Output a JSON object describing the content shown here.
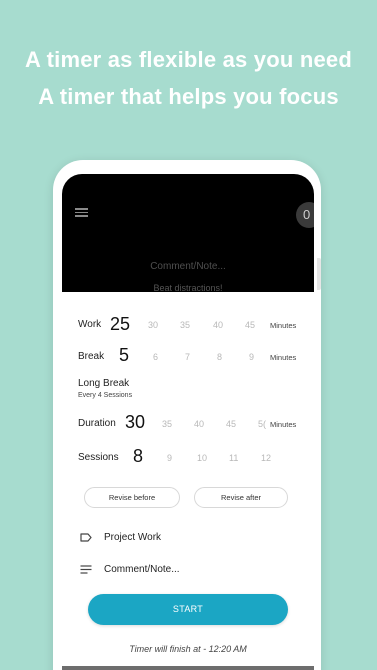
{
  "headlines": [
    "A timer as flexible as you need",
    "A timer that helps you focus"
  ],
  "top_panel": {
    "counter": "0",
    "comment_placeholder": "Comment/Note...",
    "motto": "Beat distractions!"
  },
  "settings": {
    "work": {
      "label": "Work",
      "selected": "25",
      "options": [
        "30",
        "35",
        "40",
        "45"
      ],
      "unit": "Minutes"
    },
    "break": {
      "label": "Break",
      "selected": "5",
      "options": [
        "6",
        "7",
        "8",
        "9"
      ],
      "unit": "Minutes"
    },
    "long_break": {
      "label": "Long Break",
      "subtitle": "Every 4 Sessions"
    },
    "duration": {
      "label": "Duration",
      "selected": "30",
      "options": [
        "35",
        "40",
        "45",
        "5("
      ],
      "unit": "Minutes"
    },
    "sessions": {
      "label": "Sessions",
      "selected": "8",
      "options": [
        "9",
        "10",
        "11",
        "12"
      ]
    }
  },
  "buttons": {
    "revise_before": "Revise before",
    "revise_after": "Revise after",
    "start": "START"
  },
  "fields": {
    "project": "Project Work",
    "comment": "Comment/Note..."
  },
  "finish_text": "Timer will finish at - 12:20 AM",
  "colors": {
    "background": "#a7dccf",
    "accent": "#1ba6c4"
  }
}
